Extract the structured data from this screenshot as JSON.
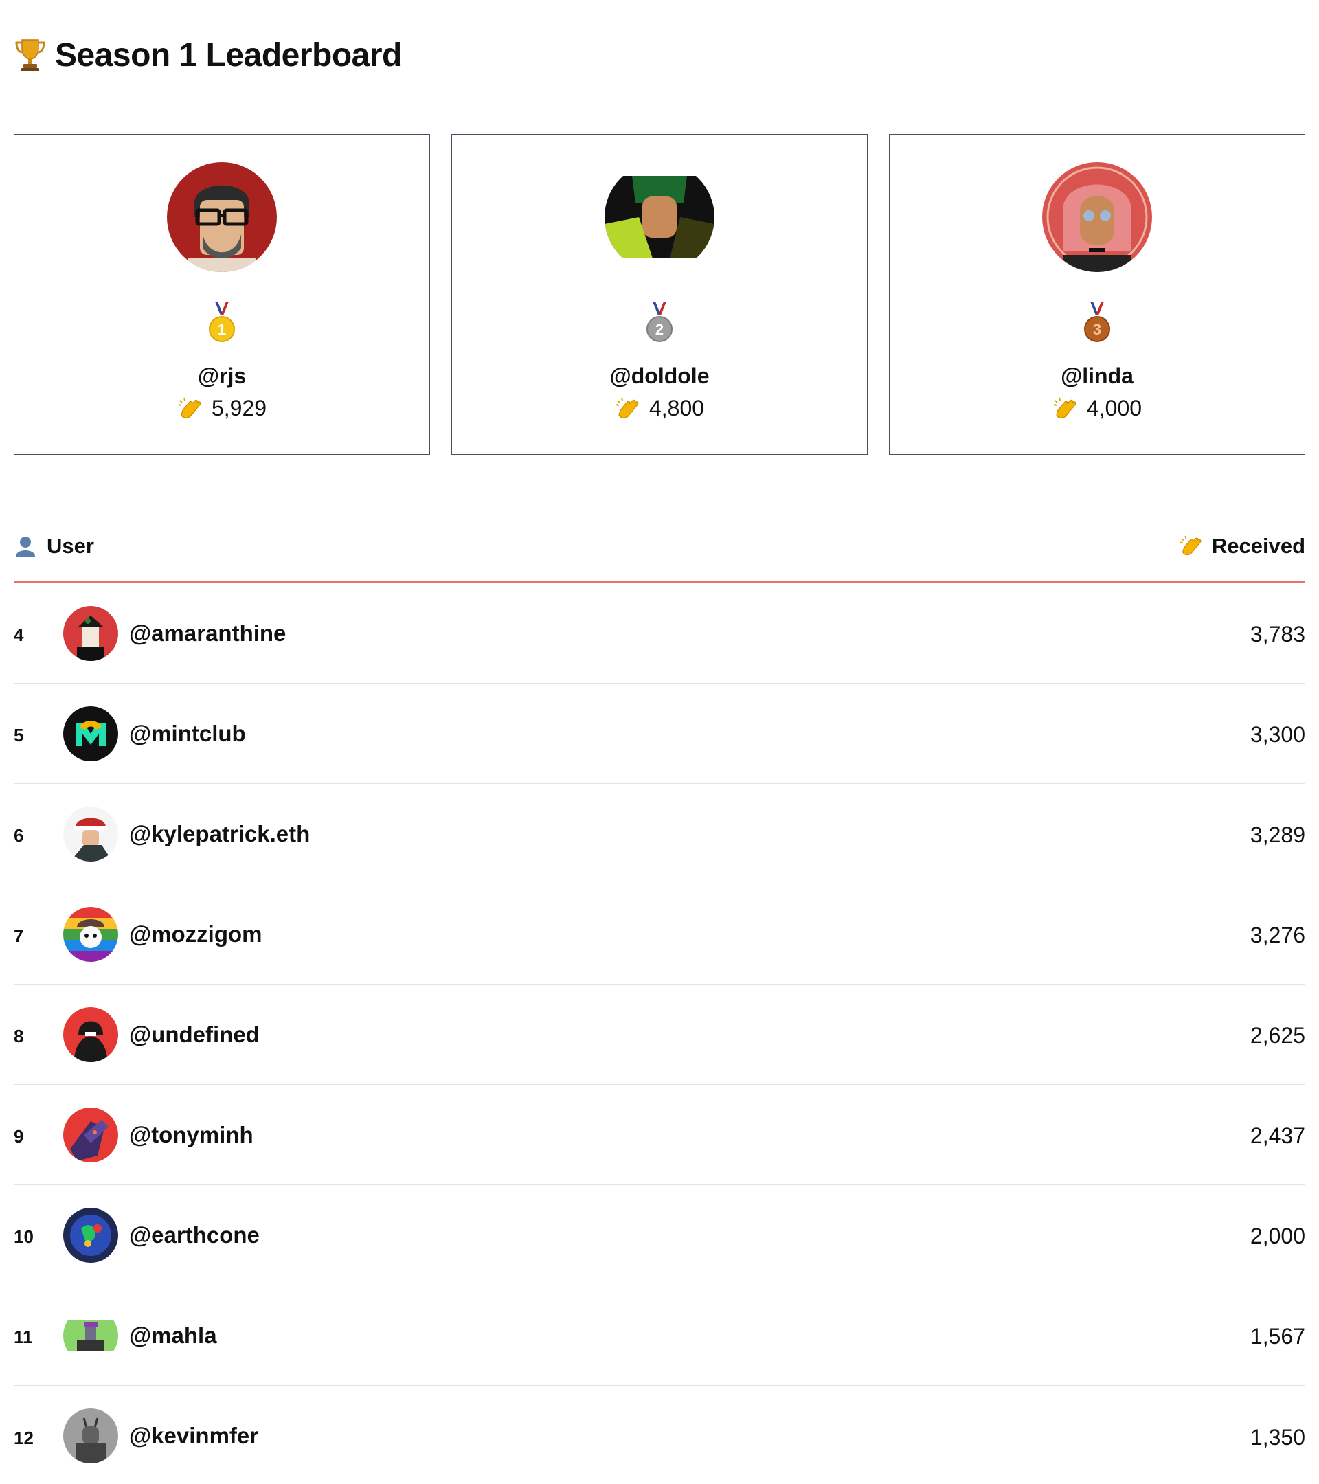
{
  "page": {
    "title": "Season 1 Leaderboard",
    "title_icon": "trophy-icon"
  },
  "podium": [
    {
      "rank": "1",
      "medal": "gold-medal-icon",
      "handle": "@rjs",
      "score": "5,929",
      "avatar_colors": [
        "#a8231f",
        "#2b2b2b"
      ]
    },
    {
      "rank": "2",
      "medal": "silver-medal-icon",
      "handle": "@doldole",
      "score": "4,800",
      "avatar_colors": [
        "#b5d62a",
        "#1a1a1a"
      ]
    },
    {
      "rank": "3",
      "medal": "bronze-medal-icon",
      "handle": "@linda",
      "score": "4,000",
      "avatar_colors": [
        "#d9534f",
        "#e8a0a0"
      ]
    }
  ],
  "table": {
    "header_user": "User",
    "header_received": "Received",
    "accent_color": "#ee6d6d",
    "rows": [
      {
        "rank": "4",
        "handle": "@amaranthine",
        "score": "3,783",
        "avatar_colors": [
          "#d63b3b",
          "#111111"
        ]
      },
      {
        "rank": "5",
        "handle": "@mintclub",
        "score": "3,300",
        "avatar_colors": [
          "#111111",
          "#22e0b0"
        ]
      },
      {
        "rank": "6",
        "handle": "@kylepatrick.eth",
        "score": "3,289",
        "avatar_colors": [
          "#ffffff",
          "#c62828"
        ]
      },
      {
        "rank": "7",
        "handle": "@mozzigom",
        "score": "3,276",
        "avatar_colors": [
          "#7c4dff",
          "#4caf50"
        ]
      },
      {
        "rank": "8",
        "handle": "@undefined",
        "score": "2,625",
        "avatar_colors": [
          "#e53935",
          "#1a1a1a"
        ]
      },
      {
        "rank": "9",
        "handle": "@tonyminh",
        "score": "2,437",
        "avatar_colors": [
          "#e53935",
          "#3f2d6b"
        ]
      },
      {
        "rank": "10",
        "handle": "@earthcone",
        "score": "2,000",
        "avatar_colors": [
          "#1e3a8a",
          "#22c55e"
        ]
      },
      {
        "rank": "11",
        "handle": "@mahla",
        "score": "1,567",
        "avatar_colors": [
          "#8bd46a",
          "#8a3fb0"
        ]
      },
      {
        "rank": "12",
        "handle": "@kevinmfer",
        "score": "1,350",
        "avatar_colors": [
          "#9e9e9e",
          "#424242"
        ]
      }
    ]
  }
}
